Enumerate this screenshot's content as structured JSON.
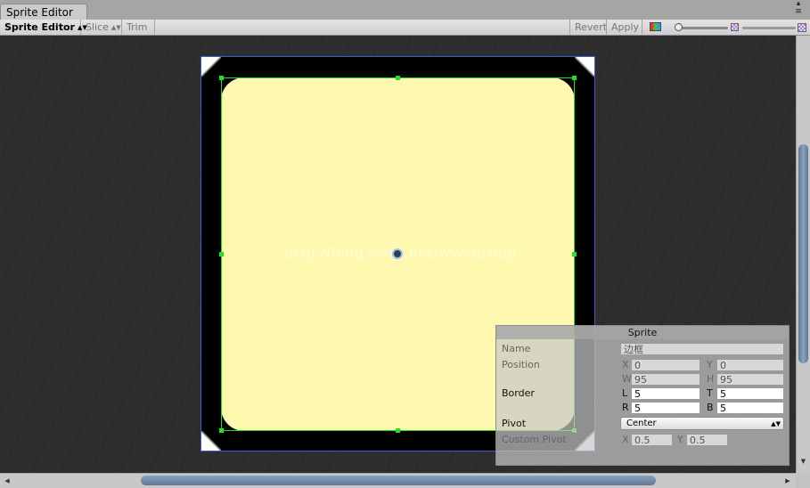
{
  "window": {
    "tab_title": "Sprite Editor",
    "controls_icon": "window-menu-icon"
  },
  "toolbar": {
    "mode_select": "Sprite Editor",
    "slice": "Slice",
    "trim": "Trim",
    "revert": "Revert",
    "apply": "Apply",
    "color_channels_icon": "rgb-channels-icon",
    "alpha_icon": "alpha-checker-icon",
    "mip_icon": "mipmap-icon"
  },
  "canvas": {
    "watermark": "http://blog.csdn.net/wwanrong",
    "colors": {
      "background": "#2e2e2e",
      "sprite_fill": "#fff9b0",
      "sprite_border": "#000000",
      "border_lines": "#22e022",
      "texture_outline": "#3a5ccc"
    }
  },
  "sprite_panel": {
    "title": "Sprite",
    "name_label": "Name",
    "name_value": "边框",
    "position_label": "Position",
    "x_label": "X",
    "x_value": "0",
    "y_label": "Y",
    "y_value": "0",
    "w_label": "W",
    "w_value": "95",
    "h_label": "H",
    "h_value": "95",
    "border_label": "Border",
    "l_label": "L",
    "l_value": "5",
    "t_label": "T",
    "t_value": "5",
    "r_label": "R",
    "r_value": "5",
    "b_label": "B",
    "b_value": "5",
    "pivot_label": "Pivot",
    "pivot_value": "Center",
    "custom_pivot_label": "Custom Pivot",
    "cp_x_label": "X",
    "cp_x_value": "0.5",
    "cp_y_label": "Y",
    "cp_y_value": "0.5"
  }
}
